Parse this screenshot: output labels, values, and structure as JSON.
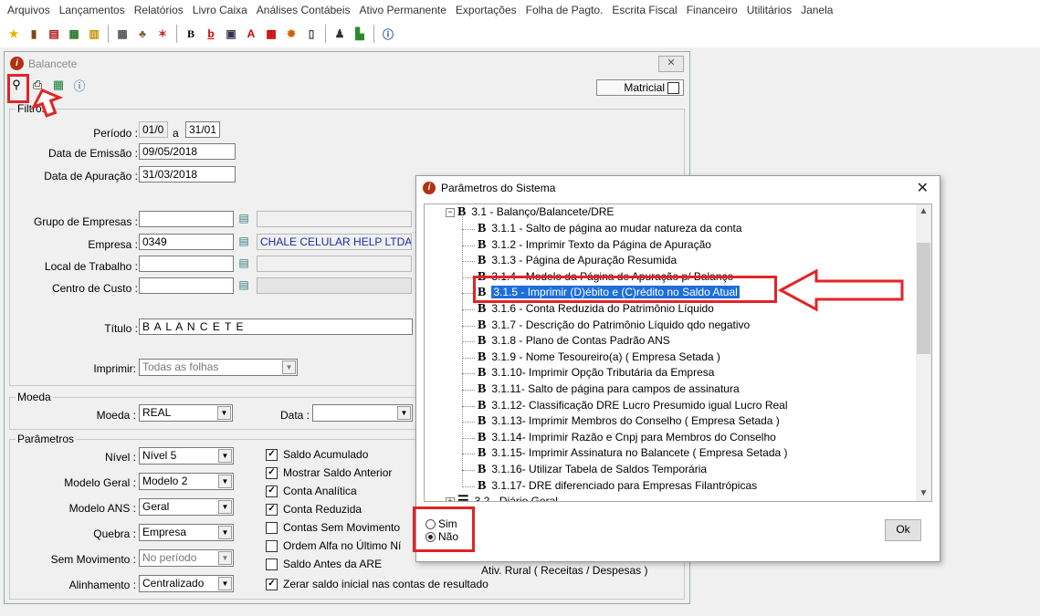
{
  "menu": [
    "Arquivos",
    "Lançamentos",
    "Relatórios",
    "Livro Caixa",
    "Análises Contábeis",
    "Ativo Permanente",
    "Exportações",
    "Folha de Pagto.",
    "Escrita Fiscal",
    "Financeiro",
    "Utilitários",
    "Janela"
  ],
  "window": {
    "title": "Balancete",
    "close_glyph": "✕",
    "matricial_label": "Matricial",
    "filtros_label": "Filtros",
    "periodo_label": "Período :",
    "periodo_from": "01/0",
    "periodo_sep": "a",
    "periodo_to": "31/01",
    "emissao_label": "Data de Emissão :",
    "emissao_value": "09/05/2018",
    "apuracao_label": "Data de Apuração :",
    "apuracao_value": "31/03/2018",
    "grupo_label": "Grupo de Empresas :",
    "grupo_value": "",
    "empresa_label": "Empresa :",
    "empresa_value": "0349",
    "empresa_name": "CHALE CELULAR HELP LTDA  ME",
    "local_label": "Local de Trabalho :",
    "local_value": "",
    "centro_label": "Centro de Custo :",
    "centro_value": "",
    "titulo_label": "Título :",
    "titulo_value": "B A L A N C E T E",
    "imprimir_label": "Imprimir:",
    "imprimir_value": "Todas as folhas",
    "moeda_group": "Moeda",
    "moeda_label": "Moeda :",
    "moeda_value": "REAL",
    "data_label": "Data :",
    "data_value": "",
    "parametros_group": "Parâmetros",
    "nivel_label": "Nível :",
    "nivel_value": "Nível 5",
    "modelo_label": "Modelo Geral :",
    "modelo_value": "Modelo 2",
    "ans_label": "Modelo ANS :",
    "ans_value": "Geral",
    "quebra_label": "Quebra :",
    "quebra_value": "Empresa",
    "semmov_label": "Sem Movimento :",
    "semmov_value": "No período",
    "alinh_label": "Alinhamento :",
    "alinh_value": "Centralizado",
    "checks": [
      {
        "label": "Saldo Acumulado",
        "checked": true
      },
      {
        "label": "Mostrar Saldo Anterior",
        "checked": true
      },
      {
        "label": "Conta Analítica",
        "checked": true
      },
      {
        "label": "Conta Reduzida",
        "checked": true
      },
      {
        "label": "Contas Sem Movimento",
        "checked": false
      },
      {
        "label": "Ordem Alfa no Último Ní",
        "checked": false
      },
      {
        "label": "Saldo Antes da ARE",
        "checked": false
      },
      {
        "label": "Zerar saldo inicial nas contas de resultado",
        "checked": true
      }
    ],
    "ativ_rural": "Ativ. Rural ( Receitas / Despesas )"
  },
  "dialog": {
    "title": "Parâmetros do Sistema",
    "close_glyph": "✕",
    "parent": "3.1 - Balanço/Balancete/DRE",
    "items": [
      "3.1.1 - Salto de página ao mudar natureza da conta",
      "3.1.2 - Imprimir Texto da Página de Apuração",
      "3.1.3 - Página de Apuração Resumida",
      "3.1.4 - Modelo da Página de Apuração p/ Balanço",
      "3.1.5 - Imprimir (D)ébito e (C)rédito no Saldo Atual",
      "3.1.6 - Conta Reduzida do Patrimônio Líquido",
      "3.1.7 - Descrição do Patrimônio Líquido qdo negativo",
      "3.1.8 - Plano de Contas Padrão ANS",
      "3.1.9 - Nome Tesoureiro(a) ( Empresa Setada )",
      "3.1.10- Imprimir Opção Tributária da Empresa",
      "3.1.11- Salto de página para campos de assinatura",
      "3.1.12- Classificação DRE Lucro Presumido igual Lucro Real",
      "3.1.13- Imprimir Membros do Conselho ( Empresa Setada )",
      "3.1.14- Imprimir Razão e Cnpj para Membros do Conselho",
      "3.1.15- Imprimir Assinatura no Balancete ( Empresa Setada )",
      "3.1.16- Utilizar Tabela de Saldos Temporária",
      "3.1.17- DRE diferenciado para Empresas Filantrópicas"
    ],
    "selected_index": 4,
    "next_group": "3.2 - Diário Geral",
    "radio_sim": "Sim",
    "radio_nao": "Não",
    "selected_radio": "Não",
    "ok_label": "Ok"
  }
}
